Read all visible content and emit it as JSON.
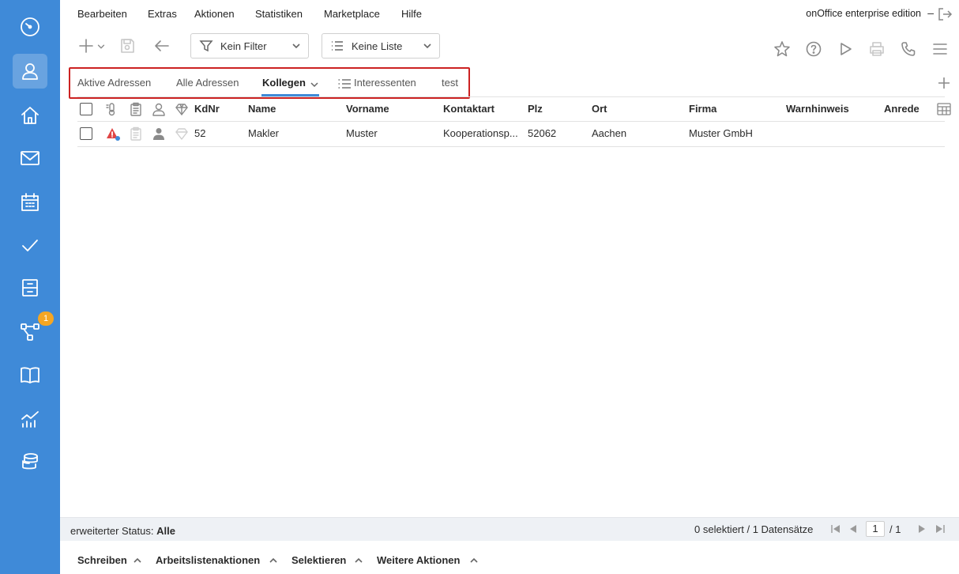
{
  "menu": {
    "items": [
      "Bearbeiten",
      "Extras",
      "Aktionen",
      "Statistiken",
      "Marketplace",
      "Hilfe"
    ],
    "edition": "onOffice enterprise edition",
    "minimize": "–"
  },
  "toolbar": {
    "filter": "Kein Filter",
    "list": "Keine Liste"
  },
  "tabs": [
    {
      "label": "Aktive Adressen"
    },
    {
      "label": "Alle Adressen"
    },
    {
      "label": "Kollegen"
    },
    {
      "label": "Interessenten"
    },
    {
      "label": "test"
    }
  ],
  "table": {
    "columns": [
      "KdNr",
      "Name",
      "Vorname",
      "Kontaktart",
      "Plz",
      "Ort",
      "Firma",
      "Warnhinweis",
      "Anrede"
    ],
    "rows": [
      {
        "kdnr": "52",
        "name": "Makler",
        "vorname": "Muster",
        "kontaktart": "Kooperationsp...",
        "plz": "52062",
        "ort": "Aachen",
        "firma": "Muster GmbH",
        "warnhinweis": "",
        "anrede": ""
      }
    ]
  },
  "status": {
    "label": "erweiterter Status:",
    "value": "Alle",
    "selected": "0 selektiert / 1 Datensätze",
    "page": "1",
    "page_total": "/ 1"
  },
  "actions": [
    "Schreiben",
    "Arbeitslistenaktionen",
    "Selektieren",
    "Weitere Aktionen"
  ],
  "nav": {
    "items": [
      "dashboard-icon",
      "address-icon",
      "property-icon",
      "email-icon",
      "calendar-icon",
      "task-icon",
      "file-cabinet-icon",
      "workflow-icon",
      "knowledge-base-icon",
      "statistics-icon",
      "database-icon"
    ],
    "workflow_badge": "1",
    "color": "#3f8ad8"
  },
  "accent_color": "#3f8ad8",
  "highlight_color": "#cc2222"
}
